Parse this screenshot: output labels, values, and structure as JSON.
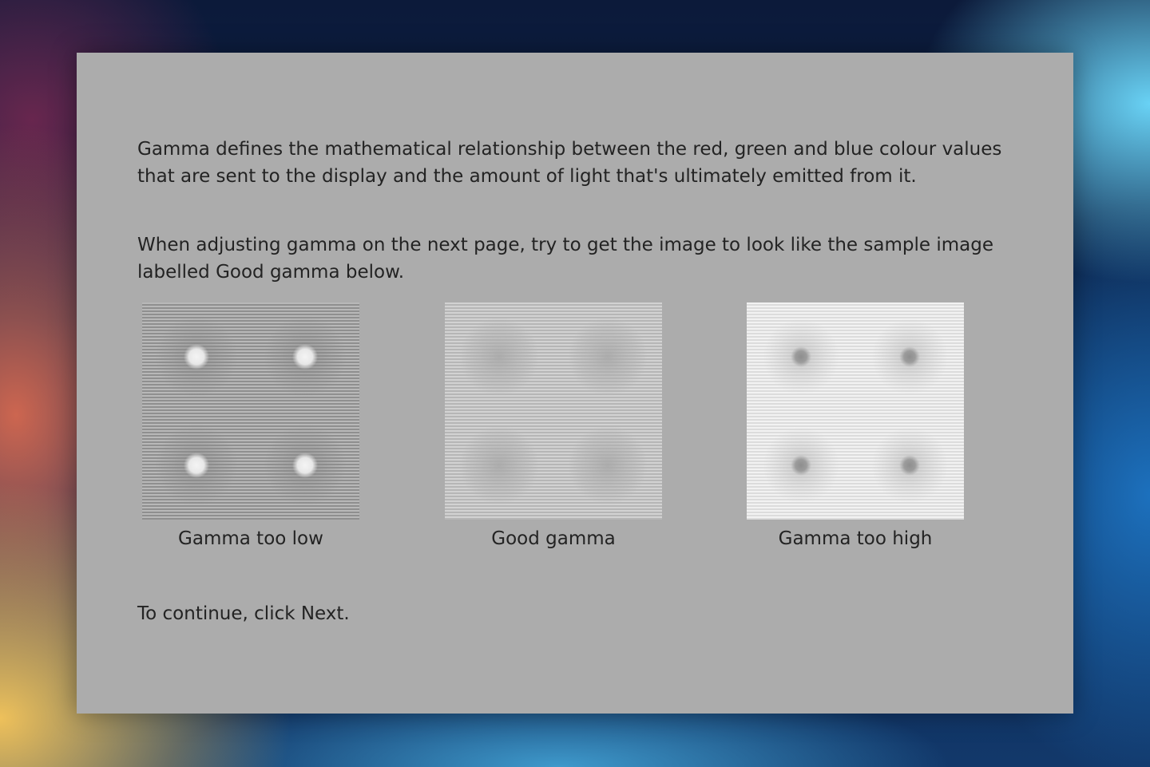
{
  "dialog": {
    "paragraph1": "Gamma defines the mathematical relationship between the red, green and blue colour values that are sent to the display and the amount of light that's ultimately emitted from it.",
    "paragraph2": "When adjusting gamma on the next page, try to get the image to look like the sample image labelled Good gamma below.",
    "continue_text": "To continue, click Next."
  },
  "samples": [
    {
      "caption": "Gamma too low"
    },
    {
      "caption": "Good gamma"
    },
    {
      "caption": "Gamma too high"
    }
  ]
}
